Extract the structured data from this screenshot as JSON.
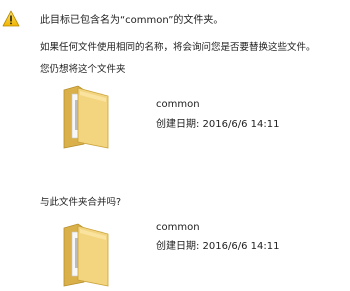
{
  "dialog": {
    "header_message": "此目标已包含名为“common”的文件夹。",
    "info_message": "如果任何文件使用相同的名称，将会询问您是否要替换这些文件。",
    "keep_prompt": "您仍想将这个文件夹",
    "merge_prompt": "与此文件夹合并吗?"
  },
  "source_folder": {
    "name": "common",
    "created": "创建日期: 2016/6/6 14:11",
    "icon": "folder-icon"
  },
  "target_folder": {
    "name": "common",
    "created": "创建日期: 2016/6/6 14:11",
    "icon": "folder-icon"
  },
  "icons": {
    "warning": "warning-icon"
  },
  "colors": {
    "warning_yellow": "#f5c400",
    "folder_yellow": "#f2d27a"
  }
}
